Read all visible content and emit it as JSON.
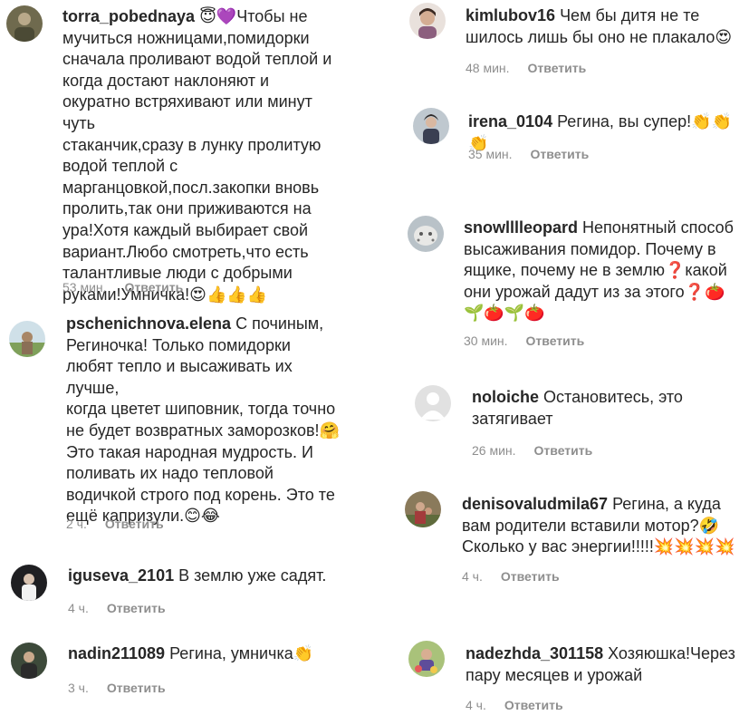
{
  "reply_label": "Ответить",
  "comments": [
    {
      "username": "torra_pobednaya",
      "text": "😇💜Чтобы не\nмучиться ножницами,помидорки\nсначала проливают водой теплой и\nкогда достают наклоняют и\nокуратно встряхивают или минут чуть\nстаканчик,сразу в лунку пролитую\nводой теплой с\nмарганцовкой,посл.закопки вновь\nпролить,так они приживаются на\nура!Хотя каждый выбирает свой\nвариант.Любо смотреть,что есть\nталантливые люди с добрыми\nруками!Умничка!😍👍👍👍",
      "time": "53 мин."
    },
    {
      "username": "pschenichnova.elena",
      "text": "С починым,\nРегиночка! Только помидорки\nлюбят тепло и высаживать их лучше,\nкогда цветет шиповник, тогда точно\nне будет возвратных заморозков!🤗\nЭто такая народная мудрость. И\nполивать их надо тепловой\nводичкой строго под корень. Это те\nещё капризули.😊😂",
      "time": "2 ч."
    },
    {
      "username": "iguseva_2101",
      "text": "В землю уже садят.",
      "time": "4 ч."
    },
    {
      "username": "nadin211089",
      "text": "Регина, умничка👏",
      "time": "3 ч."
    },
    {
      "username": "kimlubov16",
      "text": "Чем бы дитя не те\nшилось лишь бы оно не плакало😍",
      "time": "48 мин."
    },
    {
      "username": "irena_0104",
      "text": "Регина, вы супер!👏👏👏",
      "time": "35 мин."
    },
    {
      "username": "snowlllleopard",
      "text": "Непонятный способ\nвысаживания помидор. Почему в\nящике, почему не в землю❓какой\nони урожай дадут из за этого❓🍅\n🌱🍅🌱🍅",
      "time": "30 мин."
    },
    {
      "username": "noloiche",
      "text": "Остановитесь, это\nзатягивает",
      "time": "26 мин."
    },
    {
      "username": "denisovaludmila67",
      "text": "Регина, а куда\nвам родители вставили мотор?🤣\nСколько у вас энергии!!!!!💥💥💥💥",
      "time": "4 ч."
    },
    {
      "username": "nadezhda_301158",
      "text": "Хозяюшка!Через\nпару месяцев и урожай",
      "time": "4 ч."
    }
  ]
}
